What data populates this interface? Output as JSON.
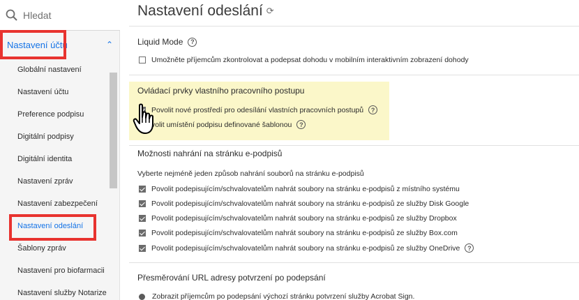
{
  "sidebar": {
    "search_placeholder": "Hledat",
    "section_label": "Nastavení účtu",
    "items": [
      {
        "label": "Globální nastavení"
      },
      {
        "label": "Nastavení účtu"
      },
      {
        "label": "Preference podpisu"
      },
      {
        "label": "Digitální podpisy"
      },
      {
        "label": "Digitální identita"
      },
      {
        "label": "Nastavení zpráv"
      },
      {
        "label": "Nastavení zabezpečení"
      },
      {
        "label": "Nastavení odeslání",
        "active": true
      },
      {
        "label": "Šablony zpráv"
      },
      {
        "label": "Nastavení pro biofarmacii"
      },
      {
        "label": "Nastavení služby Notarize"
      }
    ]
  },
  "main": {
    "title": "Nastavení odeslání",
    "liquid_mode": {
      "title": "Liquid Mode",
      "option": "Umožněte příjemcům zkontrolovat a podepsat dohodu v mobilním interaktivním zobrazení dohody",
      "checked": false
    },
    "workflow": {
      "title": "Ovládací prvky vlastního pracovního postupu",
      "option1": "Povolit nové prostředí pro odesílání vlastních pracovních postupů",
      "option1_checked": true,
      "option2": "volit umístění podpisu definované šablonou"
    },
    "upload": {
      "title": "Možnosti nahrání na stránku e-podpisů",
      "subtitle": "Vyberte nejméně jeden způsob nahrání souborů na stránku e-podpisů",
      "options": [
        "Povolit podepisujícím/schvalovatelům nahrát soubory na stránku e-podpisů z místního systému",
        "Povolit podepisujícím/schvalovatelům nahrát soubory na stránku e-podpisů ze služby Disk Google",
        "Povolit podepisujícím/schvalovatelům nahrát soubory na stránku e-podpisů ze služby Dropbox",
        "Povolit podepisujícím/schvalovatelům nahrát soubory na stránku e-podpisů ze služby Box.com",
        "Povolit podepisujícím/schvalovatelům nahrát soubory na stránku e-podpisů ze služby OneDrive"
      ]
    },
    "redirect": {
      "title": "Přesměrování URL adresy potvrzení po podepsání",
      "option": "Zobrazit příjemcům po podepsání výchozí stránku potvrzení služby Acrobat Sign."
    }
  },
  "icons": {
    "help": "?",
    "refresh": "⟳"
  },
  "colors": {
    "accent": "#1473e6",
    "highlight": "#e8332f",
    "callout": "#fbf7c9"
  }
}
